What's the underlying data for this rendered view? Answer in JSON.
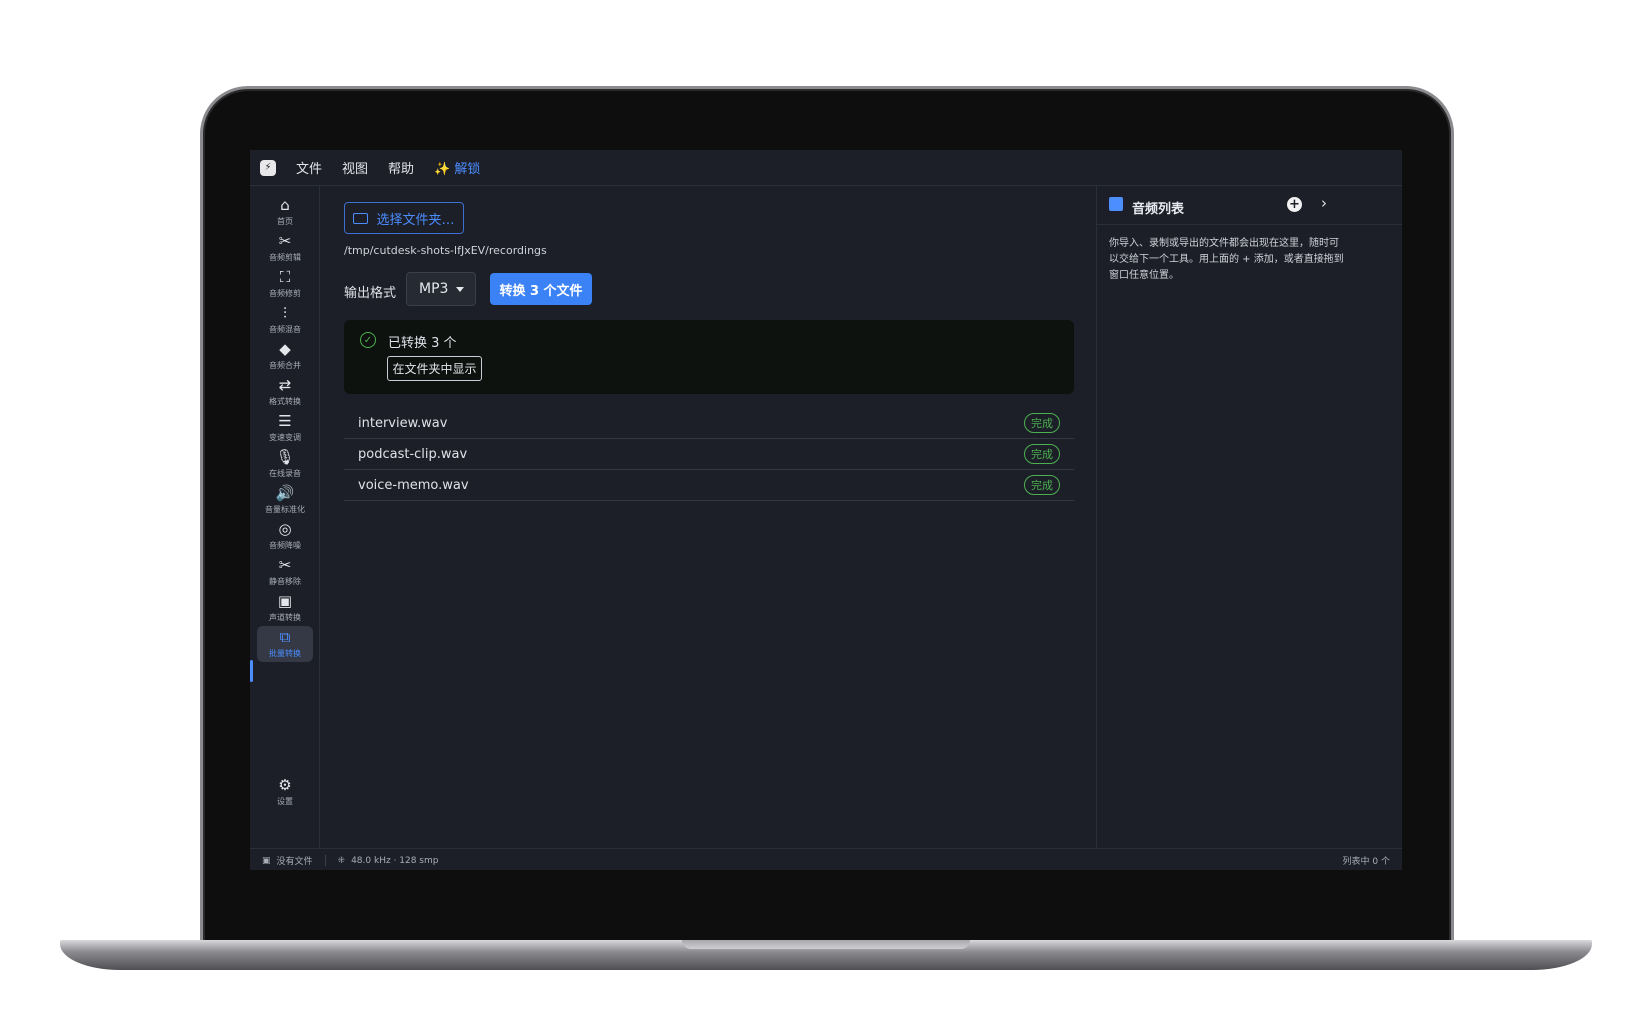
{
  "menu": {
    "logo_icon": "app-logo",
    "items": [
      "文件",
      "视图",
      "帮助"
    ],
    "unlock_label": "✨ 解锁"
  },
  "sidebar": {
    "items": [
      {
        "icon": "⌂",
        "label": "首页"
      },
      {
        "icon": "✂",
        "label": "音频剪辑"
      },
      {
        "icon": "⛶",
        "label": "音频修剪"
      },
      {
        "icon": "⫶",
        "label": "音频混音"
      },
      {
        "icon": "◆",
        "label": "音频合并"
      },
      {
        "icon": "⇄",
        "label": "格式转换"
      },
      {
        "icon": "☰",
        "label": "变速变调"
      },
      {
        "icon": "🎙",
        "label": "在线录音"
      },
      {
        "icon": "🔊",
        "label": "音量标准化"
      },
      {
        "icon": "◎",
        "label": "音频降噪"
      },
      {
        "icon": "✂",
        "label": "静音移除"
      },
      {
        "icon": "▣",
        "label": "声道转换"
      },
      {
        "icon": "⧉",
        "label": "批量转换"
      }
    ],
    "settings": {
      "icon": "⚙",
      "label": "设置"
    }
  },
  "main": {
    "choose_folder_label": "选择文件夹…",
    "path": "/tmp/cutdesk-shots-lfJxEV/recordings",
    "format_label": "输出格式",
    "format_value": "MP3",
    "convert_label": "转换 3 个文件",
    "result_text": "已转换 3 个",
    "show_in_folder_label": "在文件夹中显示",
    "files": [
      {
        "name": "interview.wav",
        "status": "完成"
      },
      {
        "name": "podcast-clip.wav",
        "status": "完成"
      },
      {
        "name": "voice-memo.wav",
        "status": "完成"
      }
    ]
  },
  "right_panel": {
    "title": "音频列表",
    "description": "你导入、录制或导出的文件都会出现在这里，随时可以交给下一个工具。用上面的 + 添加，或者直接拖到窗口任意位置。"
  },
  "statusbar": {
    "no_file": "没有文件",
    "audio_info": "48.0 kHz · 128 smp",
    "list_count": "列表中 0 个"
  },
  "colors": {
    "accent": "#3b82f6",
    "success": "#4caf50",
    "background": "#1c1f27"
  }
}
